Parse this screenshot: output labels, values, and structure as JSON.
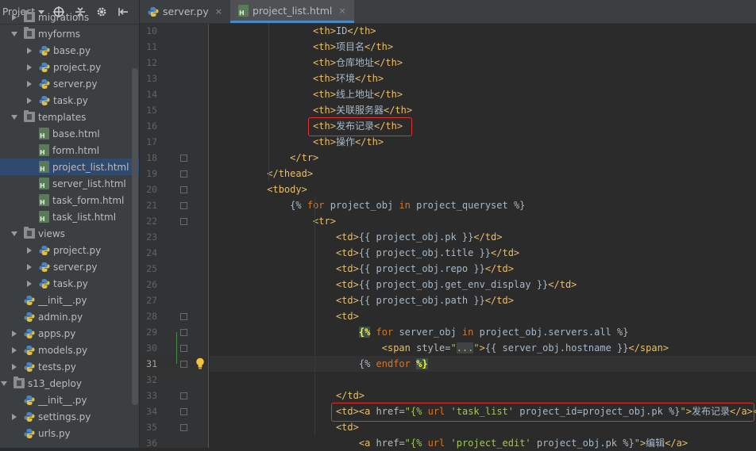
{
  "panel": {
    "title": "Project",
    "icons": [
      "crosshair-icon",
      "collapse-icon",
      "gear-icon",
      "hide-panel-icon"
    ]
  },
  "tree": [
    {
      "name": "migrations",
      "kind": "folder",
      "level": 1,
      "state": "collapsed"
    },
    {
      "name": "myforms",
      "kind": "folder",
      "level": 1,
      "state": "expanded"
    },
    {
      "name": "base.py",
      "kind": "py",
      "level": 2,
      "state": "collapsed"
    },
    {
      "name": "project.py",
      "kind": "py",
      "level": 2,
      "state": "collapsed"
    },
    {
      "name": "server.py",
      "kind": "py",
      "level": 2,
      "state": "collapsed"
    },
    {
      "name": "task.py",
      "kind": "py",
      "level": 2,
      "state": "collapsed"
    },
    {
      "name": "templates",
      "kind": "folder",
      "level": 1,
      "state": "expanded"
    },
    {
      "name": "base.html",
      "kind": "html",
      "level": 2,
      "state": "leaf"
    },
    {
      "name": "form.html",
      "kind": "html",
      "level": 2,
      "state": "leaf"
    },
    {
      "name": "project_list.html",
      "kind": "html",
      "level": 2,
      "state": "leaf",
      "selected": true
    },
    {
      "name": "server_list.html",
      "kind": "html",
      "level": 2,
      "state": "leaf"
    },
    {
      "name": "task_form.html",
      "kind": "html",
      "level": 2,
      "state": "leaf"
    },
    {
      "name": "task_list.html",
      "kind": "html",
      "level": 2,
      "state": "leaf"
    },
    {
      "name": "views",
      "kind": "folder",
      "level": 1,
      "state": "expanded"
    },
    {
      "name": "project.py",
      "kind": "py",
      "level": 2,
      "state": "collapsed"
    },
    {
      "name": "server.py",
      "kind": "py",
      "level": 2,
      "state": "collapsed"
    },
    {
      "name": "task.py",
      "kind": "py",
      "level": 2,
      "state": "collapsed"
    },
    {
      "name": "__init__.py",
      "kind": "py",
      "level": 1,
      "state": "leaf"
    },
    {
      "name": "admin.py",
      "kind": "py",
      "level": 1,
      "state": "leaf"
    },
    {
      "name": "apps.py",
      "kind": "py",
      "level": 1,
      "state": "collapsed"
    },
    {
      "name": "models.py",
      "kind": "py",
      "level": 1,
      "state": "collapsed"
    },
    {
      "name": "tests.py",
      "kind": "py",
      "level": 1,
      "state": "collapsed"
    },
    {
      "name": "s13_deploy",
      "kind": "folder",
      "level": 0,
      "state": "expanded"
    },
    {
      "name": "__init__.py",
      "kind": "py",
      "level": 1,
      "state": "leaf"
    },
    {
      "name": "settings.py",
      "kind": "py",
      "level": 1,
      "state": "collapsed"
    },
    {
      "name": "urls.py",
      "kind": "py",
      "level": 1,
      "state": "leaf"
    }
  ],
  "tabs": [
    {
      "label": "server.py",
      "kind": "py",
      "active": false
    },
    {
      "label": "project_list.html",
      "kind": "html",
      "active": true
    }
  ],
  "tab_close_glyph": "×",
  "current_line": 31,
  "boxed_lines": [
    16,
    34
  ],
  "lines": [
    {
      "n": 10,
      "indent": 14,
      "tokens": [
        [
          "tag",
          "<th>"
        ],
        [
          "txt",
          "ID"
        ],
        [
          "tag",
          "</th>"
        ]
      ]
    },
    {
      "n": 11,
      "indent": 14,
      "tokens": [
        [
          "tag",
          "<th>"
        ],
        [
          "txt",
          "项目名"
        ],
        [
          "tag",
          "</th>"
        ]
      ]
    },
    {
      "n": 12,
      "indent": 14,
      "tokens": [
        [
          "tag",
          "<th>"
        ],
        [
          "txt",
          "仓库地址"
        ],
        [
          "tag",
          "</th>"
        ]
      ]
    },
    {
      "n": 13,
      "indent": 14,
      "tokens": [
        [
          "tag",
          "<th>"
        ],
        [
          "txt",
          "环境"
        ],
        [
          "tag",
          "</th>"
        ]
      ]
    },
    {
      "n": 14,
      "indent": 14,
      "tokens": [
        [
          "tag",
          "<th>"
        ],
        [
          "txt",
          "线上地址"
        ],
        [
          "tag",
          "</th>"
        ]
      ]
    },
    {
      "n": 15,
      "indent": 14,
      "tokens": [
        [
          "tag",
          "<th>"
        ],
        [
          "txt",
          "关联服务器"
        ],
        [
          "tag",
          "</th>"
        ]
      ]
    },
    {
      "n": 16,
      "indent": 14,
      "tokens": [
        [
          "tag",
          "<th>"
        ],
        [
          "txt",
          "发布记录"
        ],
        [
          "tag",
          "</th>"
        ]
      ]
    },
    {
      "n": 17,
      "indent": 14,
      "tokens": [
        [
          "tag",
          "<th>"
        ],
        [
          "txt",
          "操作"
        ],
        [
          "tag",
          "</th>"
        ]
      ]
    },
    {
      "n": 18,
      "indent": 10,
      "tokens": [
        [
          "tag",
          "</tr>"
        ]
      ]
    },
    {
      "n": 19,
      "indent": 6,
      "tokens": [
        [
          "tag",
          "</thead>"
        ]
      ]
    },
    {
      "n": 20,
      "indent": 6,
      "tokens": [
        [
          "tag",
          "<tbody>"
        ]
      ]
    },
    {
      "n": 21,
      "indent": 10,
      "tokens": [
        [
          "txt",
          "{% "
        ],
        [
          "kw",
          "for"
        ],
        [
          "txt",
          " project_obj "
        ],
        [
          "kw",
          "in"
        ],
        [
          "txt",
          " project_queryset %}"
        ]
      ]
    },
    {
      "n": 22,
      "indent": 14,
      "tokens": [
        [
          "tag",
          "<tr>"
        ]
      ]
    },
    {
      "n": 23,
      "indent": 18,
      "tokens": [
        [
          "tag",
          "<td>"
        ],
        [
          "txt",
          "{{ project_obj.pk }}"
        ],
        [
          "tag",
          "</td>"
        ]
      ]
    },
    {
      "n": 24,
      "indent": 18,
      "tokens": [
        [
          "tag",
          "<td>"
        ],
        [
          "txt",
          "{{ project_obj.title }}"
        ],
        [
          "tag",
          "</td>"
        ]
      ]
    },
    {
      "n": 25,
      "indent": 18,
      "tokens": [
        [
          "tag",
          "<td>"
        ],
        [
          "txt",
          "{{ project_obj.repo }}"
        ],
        [
          "tag",
          "</td>"
        ]
      ]
    },
    {
      "n": 26,
      "indent": 18,
      "tokens": [
        [
          "tag",
          "<td>"
        ],
        [
          "txt",
          "{{ project_obj.get_env_display }}"
        ],
        [
          "tag",
          "</td>"
        ]
      ]
    },
    {
      "n": 27,
      "indent": 18,
      "tokens": [
        [
          "tag",
          "<td>"
        ],
        [
          "txt",
          "{{ project_obj.path }}"
        ],
        [
          "tag",
          "</td>"
        ]
      ]
    },
    {
      "n": 28,
      "indent": 18,
      "tokens": [
        [
          "tag",
          "<td>"
        ]
      ]
    },
    {
      "n": 29,
      "indent": 22,
      "tokens": [
        [
          "hlb",
          "{%"
        ],
        [
          "txt",
          " "
        ],
        [
          "kw",
          "for"
        ],
        [
          "txt",
          " server_obj "
        ],
        [
          "kw",
          "in"
        ],
        [
          "txt",
          " project_obj.servers.all %}"
        ]
      ]
    },
    {
      "n": 30,
      "indent": 26,
      "tokens": [
        [
          "tag",
          "<span "
        ],
        [
          "attr",
          "style"
        ],
        [
          "txt",
          "="
        ],
        [
          "str",
          "\""
        ],
        [
          "hlg",
          "..."
        ],
        [
          "str",
          "\""
        ],
        [
          "tag",
          ">"
        ],
        [
          "txt",
          "{{ server_obj.hostname }}"
        ],
        [
          "tag",
          "</span>"
        ]
      ]
    },
    {
      "n": 31,
      "indent": 22,
      "tokens": [
        [
          "txt",
          "{% "
        ],
        [
          "kw",
          "endfor"
        ],
        [
          "txt",
          " "
        ],
        [
          "hlb",
          "%}"
        ]
      ]
    },
    {
      "n": 32,
      "indent": 0,
      "tokens": []
    },
    {
      "n": 33,
      "indent": 18,
      "tokens": [
        [
          "tag",
          "</td>"
        ]
      ]
    },
    {
      "n": 34,
      "indent": 18,
      "tokens": [
        [
          "tag",
          "<td>"
        ],
        [
          "tag",
          "<a "
        ],
        [
          "attr",
          "href"
        ],
        [
          "txt",
          "="
        ],
        [
          "str",
          "\"{% "
        ],
        [
          "kw",
          "url"
        ],
        [
          "txt",
          " "
        ],
        [
          "str",
          "'task_list'"
        ],
        [
          "txt",
          " project_id=project_obj.pk %}"
        ],
        [
          "str",
          "\""
        ],
        [
          "tag",
          ">"
        ],
        [
          "txt",
          "发布记录"
        ],
        [
          "tag",
          "</a></td>"
        ]
      ]
    },
    {
      "n": 35,
      "indent": 18,
      "tokens": [
        [
          "tag",
          "<td>"
        ]
      ]
    },
    {
      "n": 36,
      "indent": 22,
      "tokens": [
        [
          "tag",
          "<a "
        ],
        [
          "attr",
          "href"
        ],
        [
          "txt",
          "="
        ],
        [
          "str",
          "\"{% "
        ],
        [
          "kw",
          "url"
        ],
        [
          "txt",
          " "
        ],
        [
          "str",
          "'project_edit'"
        ],
        [
          "txt",
          " project_obj.pk %}"
        ],
        [
          "str",
          "\""
        ],
        [
          "tag",
          ">"
        ],
        [
          "txt",
          "编辑"
        ],
        [
          "tag",
          "</a>"
        ]
      ]
    }
  ],
  "folding_lines": [
    18,
    19,
    20,
    21,
    22,
    28,
    29,
    30,
    31,
    33,
    34,
    35
  ],
  "colors": {
    "tag": "#e8bf6a",
    "keyword": "#cc7832",
    "string": "#a5c25c",
    "text": "#a9b7c6",
    "annotation_box": "#e03030",
    "selection": "#2f4a6e",
    "tab_underline": "#4a88c7"
  }
}
